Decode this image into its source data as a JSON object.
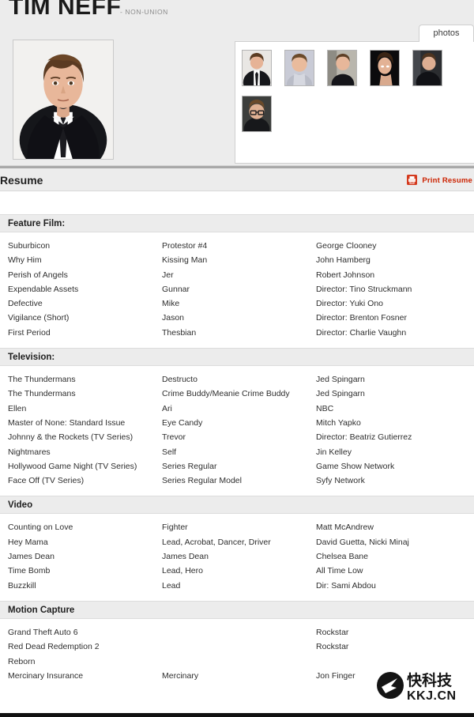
{
  "header": {
    "name": "TIM NEFF",
    "union_status": "- NON-UNION",
    "photos_tab_label": "photos",
    "headshot_alt": "headshot-photo",
    "thumbnails": [
      {
        "name": "thumb-suit-white-bg"
      },
      {
        "name": "thumb-grey-shirt"
      },
      {
        "name": "thumb-black-tee"
      },
      {
        "name": "thumb-dark-portrait"
      },
      {
        "name": "thumb-dark-profile"
      },
      {
        "name": "thumb-glasses"
      }
    ]
  },
  "resume_bar": {
    "title": "Resume",
    "print_label": "Print Resume",
    "print_icon": "printer-icon",
    "accent_color": "#cc2200"
  },
  "sections": [
    {
      "title": "Feature Film:",
      "rows": [
        {
          "project": "Suburbicon",
          "role": "Protestor #4",
          "credit": "George Clooney"
        },
        {
          "project": "Why Him",
          "role": "Kissing Man",
          "credit": "John Hamberg"
        },
        {
          "project": "Perish of Angels",
          "role": "Jer",
          "credit": "Robert Johnson"
        },
        {
          "project": "Expendable Assets",
          "role": "Gunnar",
          "credit": "Director: Tino Struckmann"
        },
        {
          "project": "Defective",
          "role": "Mike",
          "credit": "Director: Yuki Ono"
        },
        {
          "project": "Vigilance (Short)",
          "role": "Jason",
          "credit": "Director: Brenton Fosner"
        },
        {
          "project": "First Period",
          "role": "Thesbian",
          "credit": "Director: Charlie Vaughn"
        }
      ]
    },
    {
      "title": "Television:",
      "rows": [
        {
          "project": "The Thundermans",
          "role": "Destructo",
          "credit": "Jed Spingarn"
        },
        {
          "project": "The Thundermans",
          "role": "Crime Buddy/Meanie Crime Buddy",
          "credit": "Jed Spingarn"
        },
        {
          "project": "Ellen",
          "role": "Ari",
          "credit": "NBC"
        },
        {
          "project": "Master of None: Standard Issue",
          "role": "Eye Candy",
          "credit": "Mitch Yapko"
        },
        {
          "project": "Johnny & the Rockets (TV Series)",
          "role": "Trevor",
          "credit": "Director: Beatriz Gutierrez"
        },
        {
          "project": "Nightmares",
          "role": "Self",
          "credit": "Jin Kelley"
        },
        {
          "project": "Hollywood Game Night (TV Series)",
          "role": "Series Regular",
          "credit": "Game Show Network"
        },
        {
          "project": "Face Off (TV Series)",
          "role": "Series Regular Model",
          "credit": "Syfy Network"
        }
      ]
    },
    {
      "title": "Video",
      "rows": [
        {
          "project": "Counting on Love",
          "role": "Fighter",
          "credit": "Matt McAndrew"
        },
        {
          "project": "Hey Mama",
          "role": "Lead, Acrobat, Dancer, Driver",
          "credit": "David Guetta, Nicki Minaj"
        },
        {
          "project": "James Dean",
          "role": "James Dean",
          "credit": "Chelsea Bane"
        },
        {
          "project": "Time Bomb",
          "role": "Lead, Hero",
          "credit": "All Time Low"
        },
        {
          "project": "Buzzkill",
          "role": "Lead",
          "credit": "Dir: Sami Abdou"
        }
      ]
    },
    {
      "title": "Motion Capture",
      "rows": [
        {
          "project": "Grand Theft Auto 6",
          "role": "",
          "credit": "Rockstar"
        },
        {
          "project": "Red Dead Redemption 2",
          "role": "",
          "credit": "Rockstar"
        },
        {
          "project": "Reborn",
          "role": "",
          "credit": ""
        },
        {
          "project": "Mercinary Insurance",
          "role": "Mercinary",
          "credit": "Jon Finger"
        }
      ]
    }
  ],
  "watermark": {
    "cn_text": "快科技",
    "domain_text": "KKJ.CN",
    "icon": "arrow-circle-logo"
  }
}
